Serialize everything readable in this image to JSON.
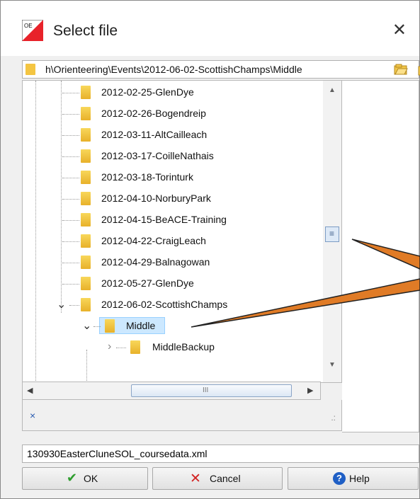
{
  "dialog": {
    "title": "Select file",
    "close_glyph": "✕",
    "app_icon": "orienteering-flag-icon"
  },
  "path": {
    "value": "h\\Orienteering\\Events\\2012-06-02-ScottishChamps\\Middle",
    "open_icon": "open-folder-icon",
    "up_icon": "up-folder-icon"
  },
  "tree": {
    "folders": [
      "2012-02-25-GlenDye",
      "2012-02-26-Bogendreip",
      "2012-03-11-AltCailleach",
      "2012-03-17-CoilleNathais",
      "2012-03-18-Torinturk",
      "2012-04-10-NorburyPark",
      "2012-04-15-BeACE-Training",
      "2012-04-22-CraigLeach",
      "2012-04-29-Balnagowan",
      "2012-05-27-GlenDye",
      "2012-06-02-ScottishChamps"
    ],
    "selected": "Middle",
    "child": "MiddleBackup",
    "expand_glyph": "⌄",
    "collapsed_glyph": "›"
  },
  "scroll": {
    "up": "▲",
    "down": "▼",
    "left": "◀",
    "right": "▶",
    "hgrip": "III",
    "vgrip": "≡"
  },
  "status": {
    "clear": "×",
    "grip": ".:"
  },
  "filename": {
    "value": "130930EasterCluneSOL_coursedata.xml"
  },
  "buttons": {
    "ok": "OK",
    "cancel": "Cancel",
    "help": "Help",
    "ok_icon": "✔",
    "cancel_icon": "✕",
    "help_icon": "?"
  },
  "colors": {
    "ok_check": "#2e9d2e",
    "cancel_x": "#d22222",
    "help_icon": "#1f5fc5",
    "selection": "#cce8ff",
    "annotation_arrow": "#e07b26"
  }
}
